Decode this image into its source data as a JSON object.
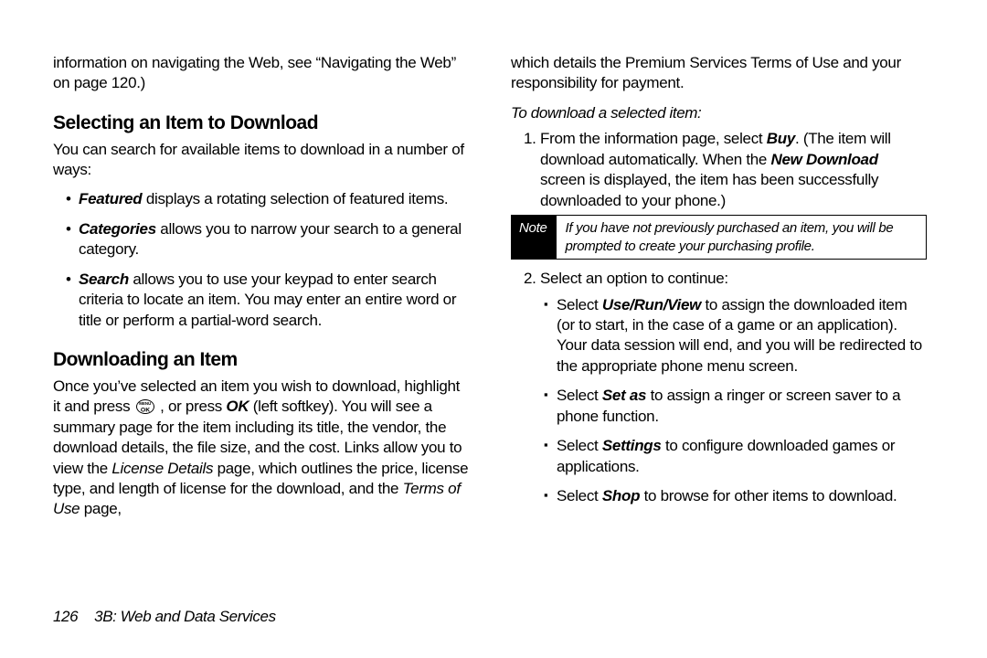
{
  "left": {
    "intro_tail": "information on navigating the Web, see “Navigating the Web” on page 120.)",
    "h_select": "Selecting an Item to Download",
    "select_intro": "You can search for available items to download in a number of ways:",
    "bullets": {
      "featured_bi": "Featured",
      "featured_rest": " displays a rotating selection of featured items.",
      "categories_bi": "Categories",
      "categories_rest": " allows you to narrow your search to a general category.",
      "search_bi": "Search",
      "search_rest": " allows you to use your keypad to enter search criteria to locate an item. You may enter an entire word or title or perform a partial-word search."
    },
    "h_download": "Downloading an Item",
    "download_para": {
      "a": "Once you’ve selected an item you wish to download, highlight it and press ",
      "ok_top": "MENU",
      "ok_bot": "OK",
      "b": " , or press ",
      "ok_bold": "OK",
      "c": " (left softkey). You will see a summary page for the item including its title, the vendor, the download details, the file size, and the cost. Links allow you to view the ",
      "license_i": "License Details",
      "d": " page, which outlines the price, license type, and length of license for the download, and the ",
      "terms_i": "Terms of Use",
      "e": " page,"
    }
  },
  "right": {
    "cont": "which details the Premium Services Terms of Use and your responsibility for payment.",
    "lead": "To download a selected item:",
    "step1": {
      "a": "From the information page, select ",
      "buy_bi": "Buy",
      "b": ". (The item will download automatically. When the ",
      "newdl_bi": "New Download",
      "c": " screen is displayed, the item has been successfully downloaded to your phone.)"
    },
    "note_label": "Note",
    "note_text": "If you have not previously purchased an item, you will be prompted to create your purchasing profile.",
    "step2_intro": "Select an option to continue:",
    "sub": {
      "useview_a": "Select ",
      "useview_bi": "Use/Run/View",
      "useview_b": " to assign the downloaded item (or to start, in the case of a game or an application). Your data session will end, and you will be redirected to the appropriate phone menu screen.",
      "setas_a": "Select ",
      "setas_bi": "Set as",
      "setas_b": " to assign a ringer or screen saver to a phone function.",
      "settings_a": "Select ",
      "settings_bi": "Settings",
      "settings_b": " to configure downloaded games or applications.",
      "shop_a": "Select ",
      "shop_bi": "Shop",
      "shop_b": " to browse for other items to download."
    }
  },
  "footer": {
    "page": "126",
    "section": "3B: Web and Data Services"
  }
}
